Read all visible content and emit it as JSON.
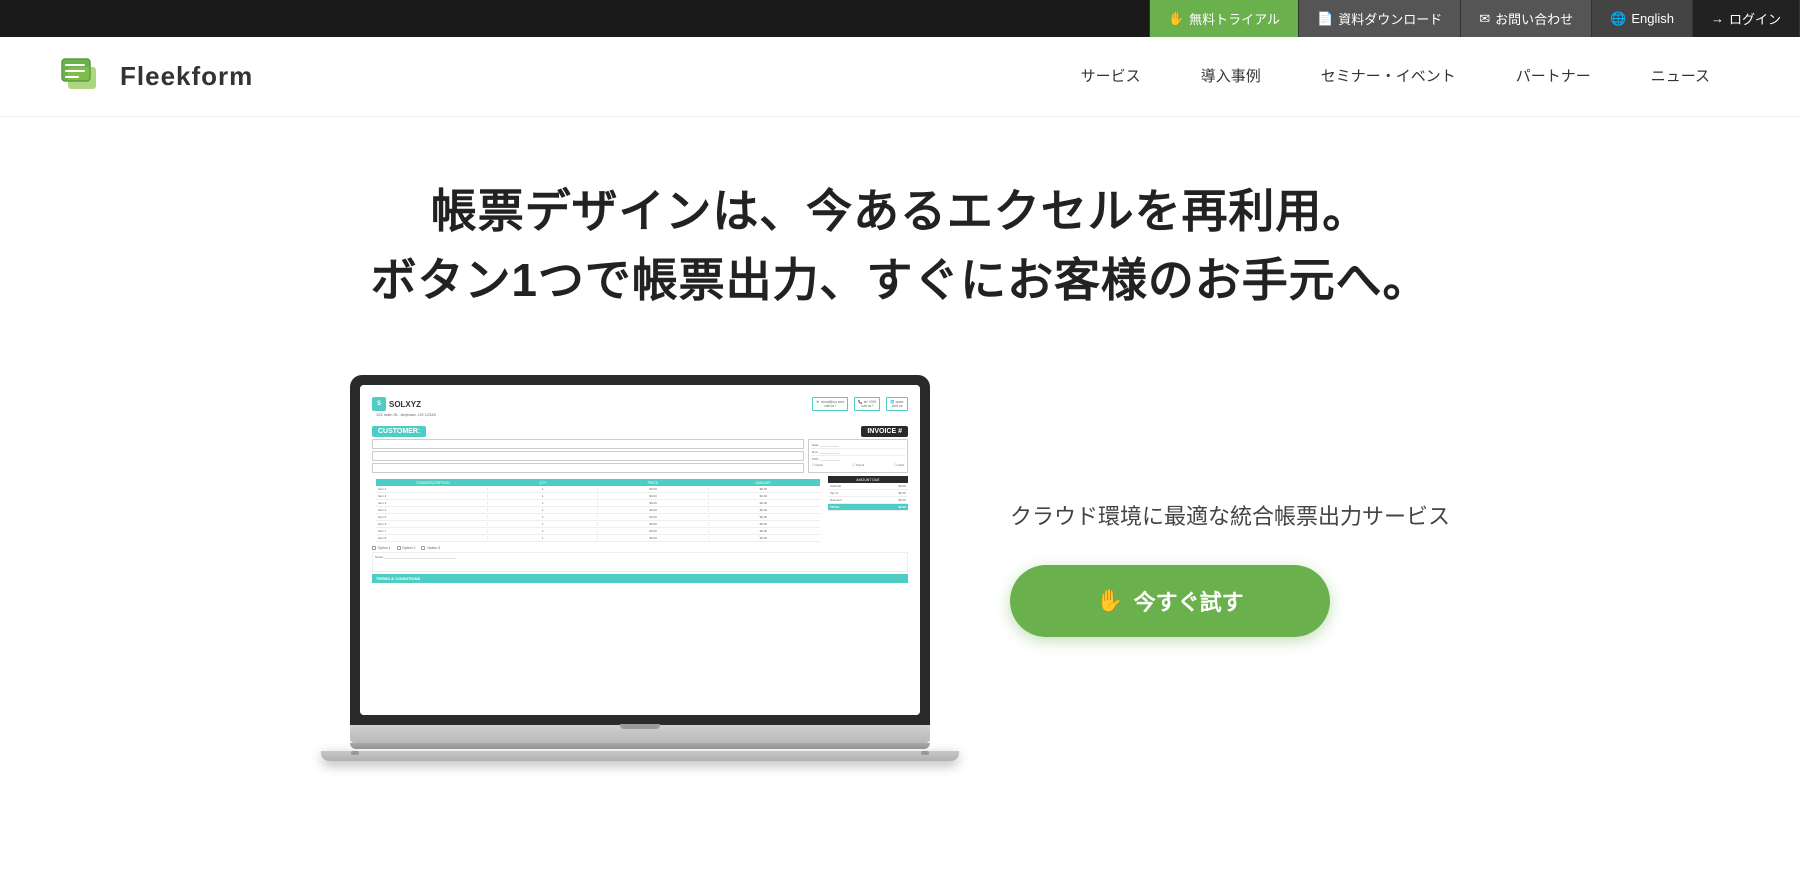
{
  "topbar": {
    "trial_label": "無料トライアル",
    "download_label": "資料ダウンロード",
    "contact_label": "お問い合わせ",
    "english_label": "English",
    "login_label": "ログイン"
  },
  "header": {
    "logo_text": "Fleekform",
    "nav": [
      {
        "id": "service",
        "label": "サービス"
      },
      {
        "id": "cases",
        "label": "導入事例"
      },
      {
        "id": "seminar",
        "label": "セミナー・イベント"
      },
      {
        "id": "partner",
        "label": "パートナー"
      },
      {
        "id": "news",
        "label": "ニュース"
      }
    ]
  },
  "hero": {
    "headline_line1": "帳票デザインは、今あるエクセルを再利用。",
    "headline_line2": "ボタン1つで帳票出力、すぐにお客様のお手元へ。"
  },
  "main": {
    "service_description": "クラウド環境に最適な統合帳票出力サービス",
    "cta_label": "今すぐ試す"
  },
  "invoice_preview": {
    "company_name": "SOLXYZ",
    "address": "123 main St., Anytown, US 12345",
    "customer_label": "CUSTOMER:",
    "invoice_label": "INVOICE #",
    "terms_label": "TERMS & CONDITIONS"
  },
  "colors": {
    "green_accent": "#6ab04c",
    "dark_bg": "#1a1a1a",
    "teal": "#4ecdc4"
  },
  "icons": {
    "trial_icon": "✋",
    "download_icon": "📄",
    "contact_icon": "✉",
    "english_icon": "🌐",
    "login_icon": "→",
    "cta_icon": "✋"
  }
}
